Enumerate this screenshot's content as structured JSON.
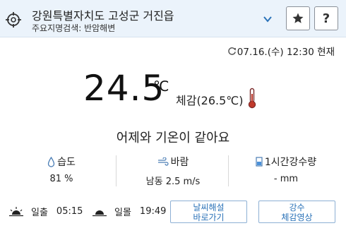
{
  "header": {
    "location": "강원특별자치도 고성군 거진읍",
    "sub": "주요지명검색: 반암해변"
  },
  "time": {
    "text": "07.16.(수) 12:30 현재"
  },
  "current": {
    "temperature": "24.5",
    "unit": "℃",
    "feels_like": "체감(26.5℃)",
    "compare": "어제와 기온이 같아요"
  },
  "stats": [
    {
      "label": "습도",
      "value": "81 %"
    },
    {
      "label": "바람",
      "value": "남동 2.5 m/s"
    },
    {
      "label": "1시간강수량",
      "value": "- mm"
    }
  ],
  "sun": {
    "sunrise_label": "일출",
    "sunrise_time": "05:15",
    "sunset_label": "일몰",
    "sunset_time": "19:49"
  },
  "buttons": {
    "weather_line1": "날씨해설",
    "weather_line2": "바로가기",
    "rain_line1": "강수",
    "rain_line2": "체감영상"
  },
  "colors": {
    "header_bg": "#ebf3fb",
    "accent": "#2a72b8",
    "thermometer": "#c0392b"
  },
  "icons": [
    "location-target-icon",
    "chevron-down-icon",
    "star-icon",
    "refresh-icon",
    "thermometer-icon",
    "droplet-icon",
    "wind-icon",
    "rain-gauge-icon",
    "sunrise-icon",
    "sunset-icon"
  ]
}
